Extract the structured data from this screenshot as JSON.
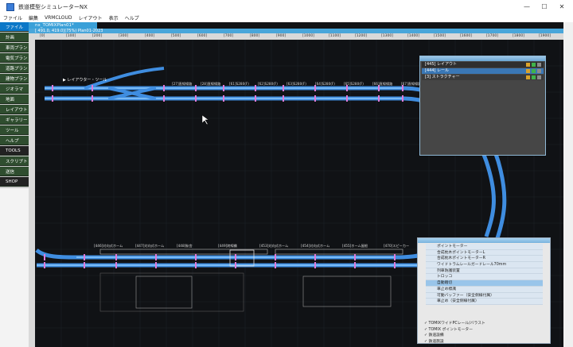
{
  "window": {
    "title": "鉄道模型シミュレーターNX",
    "minimize": "—",
    "maximize": "☐",
    "close": "✕"
  },
  "menu": [
    "ファイル",
    "編集",
    "VRMCLOUD",
    "レイアウト",
    "表示",
    "ヘルプ"
  ],
  "tools": [
    {
      "label": "ファイル",
      "style": "sel"
    },
    {
      "label": "計画",
      "style": "green"
    },
    {
      "label": "車両プラン",
      "style": "green"
    },
    {
      "label": "電気プラン",
      "style": "green"
    },
    {
      "label": "道路プラン",
      "style": "green"
    },
    {
      "label": "建物プラン",
      "style": "green"
    },
    {
      "label": "ジオラマ",
      "style": "green"
    },
    {
      "label": "地面",
      "style": "green"
    },
    {
      "label": "レイアウト",
      "style": "green"
    },
    {
      "label": "ギャラリー",
      "style": "green"
    },
    {
      "label": "ツール",
      "style": "green"
    },
    {
      "label": "ヘルプ",
      "style": "green"
    },
    {
      "label": "TOOLS",
      "style": "dark"
    },
    {
      "label": "スクリプト",
      "style": "green"
    },
    {
      "label": "送信",
      "style": "green"
    },
    {
      "label": "SHOP",
      "style": "dark"
    }
  ],
  "document": {
    "tab": "nx_TOMIXPlan01*",
    "status": "[ 491.0, 419.0](75%) Plan01-2023"
  },
  "ruler": {
    "ticks": [
      "[0]",
      "[100]",
      "[200]",
      "[300]",
      "[400]",
      "[500]",
      "[600]",
      "[700]",
      "[800]",
      "[900]",
      "[1000]",
      "[1100]",
      "[1200]",
      "[1300]",
      "[1400]",
      "[1500]",
      "[1600]",
      "[1700]",
      "[1800]",
      "[1900]"
    ]
  },
  "layout_labels": {
    "top_track": [
      "[27]直線線路",
      "[28]直線線路",
      "[61]S280(F)",
      "[62]S280(F)",
      "[63]S280(F)",
      "[64]S280(F)",
      "[65]S280(F)",
      "[66]直線線路",
      "[67]直線線路"
    ],
    "layout_marker": "▶ レイアウター・ツール",
    "bottom_track": [
      "[446]対向式ホーム",
      "[447]対向式ホーム",
      "[448]駅舎",
      "[449]跨線橋",
      "[453]対向式ホーム",
      "[454]対向式ホーム",
      "[455]ホーム屋根",
      "[470]スピーカー"
    ]
  },
  "layer_panel": {
    "rows": [
      {
        "label": "[445] レイアウト",
        "color": "#2f2f2f"
      },
      {
        "label": "[444] レール",
        "color": "#3a77b5"
      },
      {
        "label": "[3] ストラクチャー",
        "color": "#3a3a3a"
      }
    ]
  },
  "parts_panel": {
    "items": [
      "ポイントモーター",
      "合成枕木ポイントモーターL",
      "合成枕木ポイントモーターR",
      "ワイドトラムレールガードレール70mm",
      "列車防護装置",
      "トロッコ",
      "自動踏切",
      "車止め標識",
      "可動バッファー（安全側線付属）",
      "車止め（安全側線付属）"
    ],
    "selected": 6,
    "tree": [
      "TOMIXワイドPCレール/バラスト",
      "TOMIX ポイントモーター",
      "鉄道設備",
      "鉄道施設"
    ]
  }
}
